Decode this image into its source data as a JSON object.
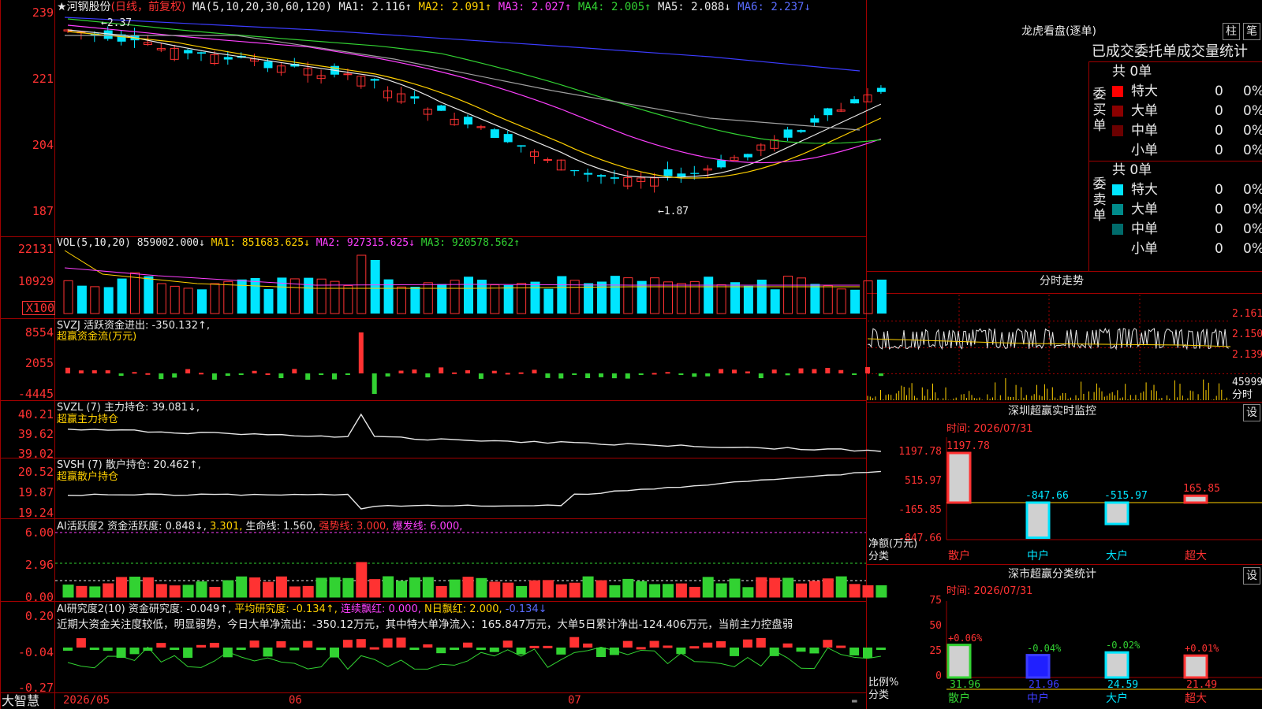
{
  "colors": {
    "up": "#ff3232",
    "down": "#00e5ff",
    "grid": "#a00000",
    "ma1": "#e8e8e8",
    "ma2": "#ffd000",
    "ma3": "#ff40ff",
    "ma4": "#32d232",
    "ma5": "#a0a0a0",
    "ma6": "#3c3cff"
  },
  "header": {
    "star": "★",
    "stock_name": "河钢股份",
    "period": "(日线，前复权)",
    "ma_label": "MA(5,10,20,30,60,120)",
    "ma1": "MA1: 2.116↑",
    "ma2": "MA2: 2.091↑",
    "ma3": "MA3: 2.027↑",
    "ma4": "MA4: 2.005↑",
    "ma5": "MA5: 2.088↓",
    "ma6": "MA6: 2.237↓"
  },
  "price_axis": [
    "239",
    "221",
    "204",
    "187"
  ],
  "price_annotations": {
    "high": "←2.37",
    "low": "←1.87"
  },
  "vol": {
    "label": "VOL(5,10,20) 859002.000↓",
    "ma1": "MA1: 851683.625↓",
    "ma2": "MA2: 927315.625↓",
    "ma3": "MA3: 920578.562↑",
    "axis": [
      "22131",
      "10929",
      "X100"
    ]
  },
  "svzj": {
    "line1": "SVZJ  活跃资金进出: -350.132↑,",
    "line2": "超赢资金流(万元)",
    "axis": [
      "8554",
      "2055",
      "-4445"
    ]
  },
  "svzl": {
    "line1": "SVZL (7) 主力持仓: 39.081↓,",
    "line2": "超赢主力持仓",
    "axis": [
      "40.21",
      "39.62",
      "39.02"
    ]
  },
  "svsh": {
    "line1": "SVSH (7) 散户持仓: 20.462↑,",
    "line2": "超赢散户持仓",
    "axis": [
      "20.52",
      "19.87",
      "19.24"
    ]
  },
  "ai1": {
    "label": "AI活跃度2 资金活跃度: 0.848↓,",
    "v2": "3.301,",
    "v3": "生命线: 1.560,",
    "v4": "强势线: 3.000,",
    "v5": "爆发线: 6.000,",
    "axis": [
      "6.00",
      "2.96",
      "0.00"
    ]
  },
  "ai2": {
    "label": "AI研究度2(10) 资金研究度: -0.049↑,",
    "v2": "平均研究度: -0.134↑,",
    "v3": "连续飘红: 0.000,",
    "v4": "N日飘红: 2.000,",
    "v5": "-0.134↓",
    "comment": "近期大资金关注度较低，明显弱势，今日大单净流出：-350.12万元，其中特大单净流入：165.847万元，大单5日累计净出-124.406万元，当前主力控盘弱",
    "axis": [
      "0.20",
      "-0.04",
      "-0.27"
    ]
  },
  "bottom_axis": {
    "brand": "大智慧",
    "dates": [
      "2026/05",
      "06",
      "07"
    ]
  },
  "lhb": {
    "title": "龙虎看盘(逐单)",
    "tab1": "柱",
    "tab2": "笔",
    "subtitle": "已成交委托单成交量统计",
    "buy_label": "委买单",
    "sell_label": "委卖单",
    "buy_total": "共 0单",
    "sell_total": "共 0单",
    "buy_rows": [
      {
        "name": "特大",
        "count": "0",
        "pct": "0%"
      },
      {
        "name": "大单",
        "count": "0",
        "pct": "0%"
      },
      {
        "name": "中单",
        "count": "0",
        "pct": "0%"
      },
      {
        "name": "小单",
        "count": "0",
        "pct": "0%"
      }
    ],
    "sell_rows": [
      {
        "name": "特大",
        "count": "0",
        "pct": "0%"
      },
      {
        "name": "大单",
        "count": "0",
        "pct": "0%"
      },
      {
        "name": "中单",
        "count": "0",
        "pct": "0%"
      },
      {
        "name": "小单",
        "count": "0",
        "pct": "0%"
      }
    ]
  },
  "intraday": {
    "title": "分时走势",
    "axis": [
      "2.161",
      "2.150",
      "2.139",
      "45999"
    ],
    "vol_label": "分时"
  },
  "monitor": {
    "title": "深圳超赢实时监控",
    "set_label": "设",
    "time": "时间: 2026/07/31",
    "axis": [
      "1197.78",
      "515.97",
      "-165.85",
      "-847.66"
    ],
    "ylabel": "净额(万元)",
    "xlabel": "分类",
    "bars": [
      {
        "name": "散户",
        "value": "1197.78",
        "num": 1197.78
      },
      {
        "name": "中户",
        "value": "-847.66",
        "num": -847.66
      },
      {
        "name": "大户",
        "value": "-515.97",
        "num": -515.97
      },
      {
        "name": "超大",
        "value": "165.85",
        "num": 165.85
      }
    ]
  },
  "classify": {
    "title": "深市超赢分类统计",
    "set_label": "设",
    "time": "时间: 2026/07/31",
    "axis": [
      "75",
      "50",
      "25",
      "0"
    ],
    "ylabel": "比例%",
    "xlabel": "分类",
    "bars": [
      {
        "name": "散户",
        "delta": "+0.06%",
        "value": "31.96",
        "num": 31.96
      },
      {
        "name": "中户",
        "delta": "-0.04%",
        "value": "21.96",
        "num": 21.96
      },
      {
        "name": "大户",
        "delta": "-0.02%",
        "value": "24.59",
        "num": 24.59
      },
      {
        "name": "超大",
        "delta": "+0.01%",
        "value": "21.49",
        "num": 21.49
      }
    ]
  },
  "chart_data": {
    "type": "bar",
    "title": "深圳超赢实时监控",
    "categories": [
      "散户",
      "中户",
      "大户",
      "超大"
    ],
    "values": [
      1197.78,
      -847.66,
      -515.97,
      165.85
    ],
    "ylabel": "净额(万元)",
    "xlabel": "分类",
    "ylim": [
      -847.66,
      1197.78
    ]
  }
}
